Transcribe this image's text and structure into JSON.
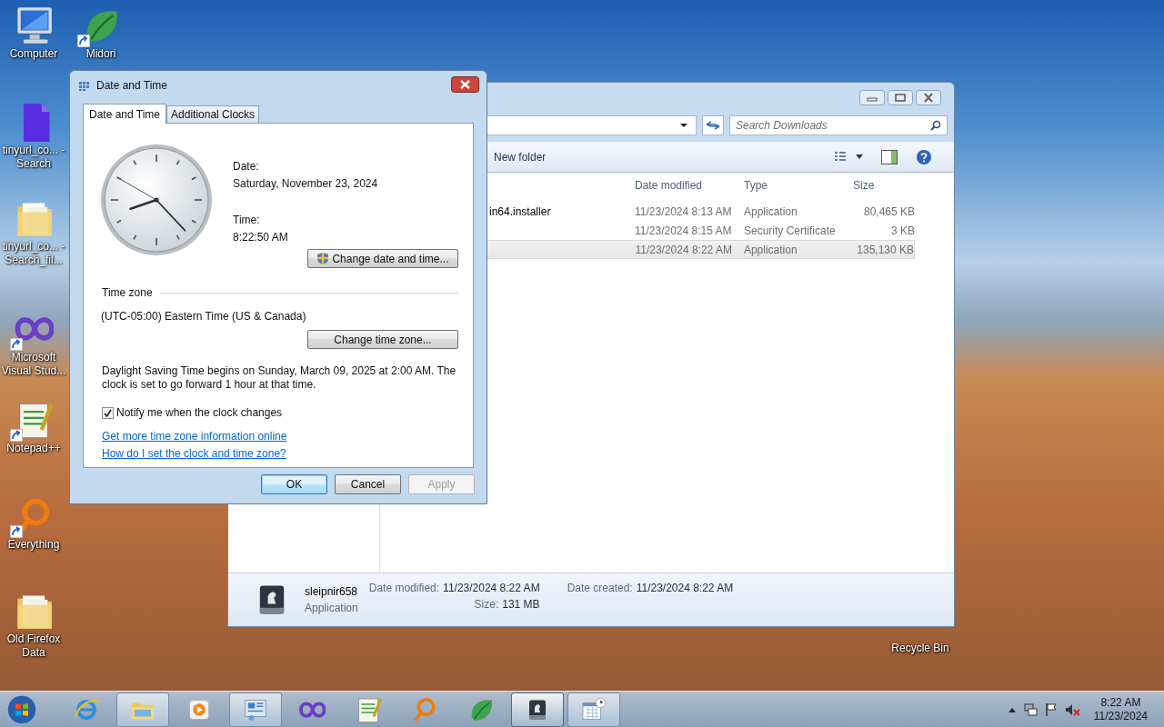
{
  "desktop_icons": [
    {
      "label": "Computer",
      "kind": "computer",
      "shortcut": false
    },
    {
      "label": "Midori",
      "kind": "midori",
      "shortcut": true
    },
    {
      "label": "tinyurl_co... - Search",
      "kind": "document",
      "shortcut": false
    },
    {
      "label": "tinyurl_co... - Search_fil...",
      "kind": "folder",
      "shortcut": false
    },
    {
      "label": "Microsoft Visual Stud...",
      "kind": "vs",
      "shortcut": true
    },
    {
      "label": "Notepad++",
      "kind": "notepad",
      "shortcut": true
    },
    {
      "label": "Everything",
      "kind": "everything",
      "shortcut": true
    },
    {
      "label": "Old Firefox Data",
      "kind": "folder",
      "shortcut": false
    },
    {
      "label": "Recycle Bin",
      "kind": "recycle",
      "shortcut": false
    }
  ],
  "explorer": {
    "search": {
      "placeholder": "Search Downloads"
    },
    "toolbar": {
      "new_folder": "New folder"
    },
    "columns": [
      "Date modified",
      "Type",
      "Size"
    ],
    "rows": [
      {
        "name": "in64.installer",
        "date": "11/23/2024 8:13 AM",
        "type": "Application",
        "size": "80,465 KB",
        "selected": false
      },
      {
        "name": "",
        "date": "11/23/2024 8:15 AM",
        "type": "Security Certificate",
        "size": "3 KB",
        "selected": false
      },
      {
        "name": "",
        "date": "11/23/2024 8:22 AM",
        "type": "Application",
        "size": "135,130 KB",
        "selected": true
      }
    ],
    "details": {
      "name": "sleipnir658",
      "type": "Application",
      "fields": [
        {
          "label": "Date modified:",
          "value": "11/23/2024 8:22 AM"
        },
        {
          "label": "Date created:",
          "value": "11/23/2024 8:22 AM"
        },
        {
          "label": "Size:",
          "value": "131 MB"
        }
      ]
    }
  },
  "dialog": {
    "title": "Date and Time",
    "tabs": [
      {
        "label": "Date and Time",
        "selected": true
      },
      {
        "label": "Additional Clocks",
        "selected": false
      }
    ],
    "date_label": "Date:",
    "date_value": "Saturday, November 23, 2024",
    "time_label": "Time:",
    "time_value": "8:22:50 AM",
    "change_date_button": "Change date and time...",
    "time_zone_heading": "Time zone",
    "time_zone": "(UTC-05:00) Eastern Time (US & Canada)",
    "change_zone_button": "Change time zone...",
    "dst_text": "Daylight Saving Time begins on Sunday, March 09, 2025 at 2:00 AM. The clock is set to go forward 1 hour at that time.",
    "notify": {
      "label": "Notify me when the clock changes",
      "checked": true
    },
    "links": [
      "Get more time zone information online",
      "How do I set the clock and time zone?"
    ],
    "buttons": [
      {
        "label": "OK",
        "default": true,
        "disabled": false
      },
      {
        "label": "Cancel",
        "default": false,
        "disabled": false
      },
      {
        "label": "Apply",
        "default": false,
        "disabled": true
      }
    ]
  },
  "taskbar": {
    "items": [
      {
        "kind": "ie",
        "open": false,
        "selected": false
      },
      {
        "kind": "explorer",
        "open": true,
        "selected": false
      },
      {
        "kind": "media",
        "open": false,
        "selected": false
      },
      {
        "kind": "control",
        "open": true,
        "selected": false
      },
      {
        "kind": "vs",
        "open": false,
        "selected": false
      },
      {
        "kind": "notepad",
        "open": false,
        "selected": false
      },
      {
        "kind": "everything",
        "open": false,
        "selected": false
      },
      {
        "kind": "midori",
        "open": false,
        "selected": false
      },
      {
        "kind": "sleipnir",
        "open": true,
        "selected": true
      },
      {
        "kind": "datetime",
        "open": true,
        "selected": false
      }
    ],
    "clock": {
      "time": "8:22 AM",
      "date": "11/23/2024"
    }
  }
}
